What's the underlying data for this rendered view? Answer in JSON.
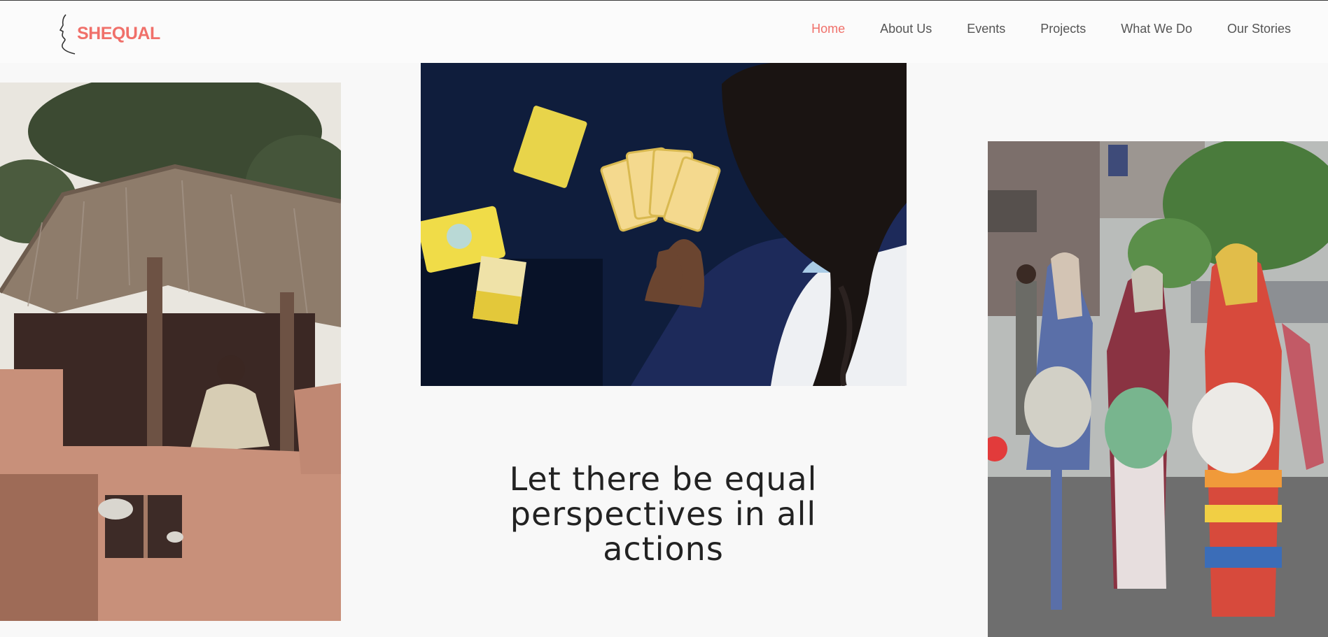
{
  "brand": {
    "name": "SHEQUAL",
    "color": "#f0706a"
  },
  "nav": {
    "items": [
      {
        "label": "Home",
        "active": true
      },
      {
        "label": "About Us",
        "active": false
      },
      {
        "label": "Events",
        "active": false
      },
      {
        "label": "Projects",
        "active": false
      },
      {
        "label": "What We Do",
        "active": false
      },
      {
        "label": "Our Stories",
        "active": false
      }
    ]
  },
  "hero": {
    "tagline_lines": [
      "Let there be equal",
      "perspectives in all",
      "actions"
    ]
  },
  "images": [
    {
      "name": "woman-sitting-in-thatched-hut-photo"
    },
    {
      "name": "girl-holding-response-cards-photo"
    },
    {
      "name": "women-walking-with-bags-photo"
    }
  ],
  "colors": {
    "accent": "#f0706a",
    "nav_text": "#555555",
    "heading": "#222222",
    "background": "#f8f8f8"
  }
}
